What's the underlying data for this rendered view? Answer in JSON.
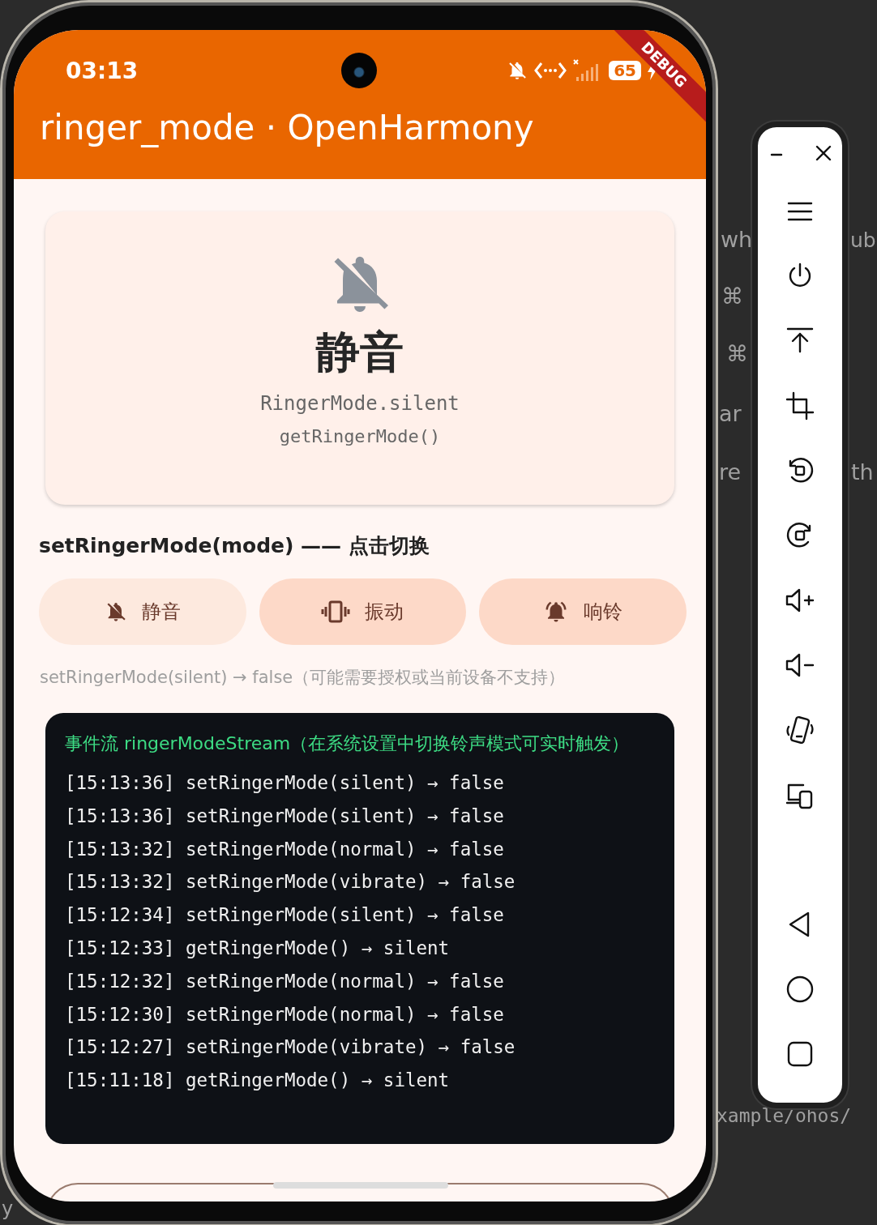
{
  "background_editor": {
    "fragments": [
      "wh",
      "ub",
      "⌘",
      "⌘",
      "ar",
      "re",
      "th",
      "xample/ohos/",
      "y"
    ]
  },
  "status_bar": {
    "time": "03:13",
    "battery": "65",
    "debug_banner": "DEBUG"
  },
  "app_bar": {
    "title": "ringer_mode · OpenHarmony"
  },
  "current_mode": {
    "label": "静音",
    "enum": "RingerMode.silent",
    "source": "getRingerMode()"
  },
  "section_title": "setRingerMode(mode) —— 点击切换",
  "mode_buttons": [
    {
      "kind": "silent",
      "label": "静音",
      "selected": true
    },
    {
      "kind": "vibrate",
      "label": "振动",
      "selected": false
    },
    {
      "kind": "normal",
      "label": "响铃",
      "selected": false
    }
  ],
  "result_note": "setRingerMode(silent) → false（可能需要授权或当前设备不支持）",
  "event_log": {
    "title": "事件流 ringerModeStream（在系统设置中切换铃声模式可实时触发）",
    "lines": [
      "[15:13:36] setRingerMode(silent) → false",
      "[15:13:36] setRingerMode(silent) → false",
      "[15:13:32] setRingerMode(normal) → false",
      "[15:13:32] setRingerMode(vibrate) → false",
      "[15:12:34] setRingerMode(silent) → false",
      "[15:12:33] getRingerMode() → silent",
      "[15:12:32] setRingerMode(normal) → false",
      "[15:12:30] setRingerMode(normal) → false",
      "[15:12:27] setRingerMode(vibrate) → false",
      "[15:11:18] getRingerMode() → silent"
    ]
  },
  "emulator_toolbar": {
    "buttons": [
      {
        "kind": "minimize"
      },
      {
        "kind": "close"
      },
      {
        "kind": "menu"
      },
      {
        "kind": "power"
      },
      {
        "kind": "top"
      },
      {
        "kind": "crop"
      },
      {
        "kind": "rotate-left"
      },
      {
        "kind": "rotate-right"
      },
      {
        "kind": "volume-up"
      },
      {
        "kind": "volume-down"
      },
      {
        "kind": "shake"
      },
      {
        "kind": "devices"
      },
      {
        "kind": "back"
      },
      {
        "kind": "home"
      },
      {
        "kind": "recents"
      }
    ]
  }
}
